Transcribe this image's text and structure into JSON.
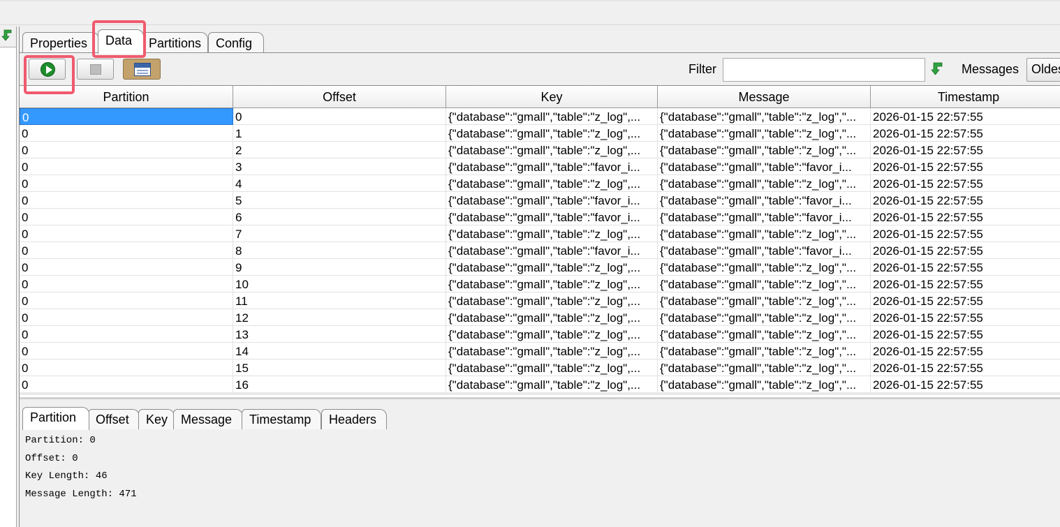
{
  "tabs": [
    {
      "label": "Properties",
      "active": false
    },
    {
      "label": "Data",
      "active": true
    },
    {
      "label": "Partitions",
      "active": false
    },
    {
      "label": "Config",
      "active": false
    }
  ],
  "toolbar": {
    "filter_label": "Filter",
    "filter_value": "",
    "messages_label": "Messages",
    "messages_value": "Oldest"
  },
  "table": {
    "columns": [
      "Partition",
      "Offset",
      "Key",
      "Message",
      "Timestamp"
    ],
    "selected_row": 0,
    "rows": [
      [
        "0",
        "0",
        "{\"database\":\"gmall\",\"table\":\"z_log\",...",
        "{\"database\":\"gmall\",\"table\":\"z_log\",\"...",
        "2026-01-15 22:57:55"
      ],
      [
        "0",
        "1",
        "{\"database\":\"gmall\",\"table\":\"z_log\",...",
        "{\"database\":\"gmall\",\"table\":\"z_log\",\"...",
        "2026-01-15 22:57:55"
      ],
      [
        "0",
        "2",
        "{\"database\":\"gmall\",\"table\":\"z_log\",...",
        "{\"database\":\"gmall\",\"table\":\"z_log\",\"...",
        "2026-01-15 22:57:55"
      ],
      [
        "0",
        "3",
        "{\"database\":\"gmall\",\"table\":\"favor_i...",
        "{\"database\":\"gmall\",\"table\":\"favor_i...",
        "2026-01-15 22:57:55"
      ],
      [
        "0",
        "4",
        "{\"database\":\"gmall\",\"table\":\"z_log\",...",
        "{\"database\":\"gmall\",\"table\":\"z_log\",\"...",
        "2026-01-15 22:57:55"
      ],
      [
        "0",
        "5",
        "{\"database\":\"gmall\",\"table\":\"favor_i...",
        "{\"database\":\"gmall\",\"table\":\"favor_i...",
        "2026-01-15 22:57:55"
      ],
      [
        "0",
        "6",
        "{\"database\":\"gmall\",\"table\":\"favor_i...",
        "{\"database\":\"gmall\",\"table\":\"favor_i...",
        "2026-01-15 22:57:55"
      ],
      [
        "0",
        "7",
        "{\"database\":\"gmall\",\"table\":\"z_log\",...",
        "{\"database\":\"gmall\",\"table\":\"z_log\",\"...",
        "2026-01-15 22:57:55"
      ],
      [
        "0",
        "8",
        "{\"database\":\"gmall\",\"table\":\"favor_i...",
        "{\"database\":\"gmall\",\"table\":\"favor_i...",
        "2026-01-15 22:57:55"
      ],
      [
        "0",
        "9",
        "{\"database\":\"gmall\",\"table\":\"z_log\",...",
        "{\"database\":\"gmall\",\"table\":\"z_log\",\"...",
        "2026-01-15 22:57:55"
      ],
      [
        "0",
        "10",
        "{\"database\":\"gmall\",\"table\":\"z_log\",...",
        "{\"database\":\"gmall\",\"table\":\"z_log\",\"...",
        "2026-01-15 22:57:55"
      ],
      [
        "0",
        "11",
        "{\"database\":\"gmall\",\"table\":\"z_log\",...",
        "{\"database\":\"gmall\",\"table\":\"z_log\",\"...",
        "2026-01-15 22:57:55"
      ],
      [
        "0",
        "12",
        "{\"database\":\"gmall\",\"table\":\"z_log\",...",
        "{\"database\":\"gmall\",\"table\":\"z_log\",\"...",
        "2026-01-15 22:57:55"
      ],
      [
        "0",
        "13",
        "{\"database\":\"gmall\",\"table\":\"z_log\",...",
        "{\"database\":\"gmall\",\"table\":\"z_log\",\"...",
        "2026-01-15 22:57:55"
      ],
      [
        "0",
        "14",
        "{\"database\":\"gmall\",\"table\":\"z_log\",...",
        "{\"database\":\"gmall\",\"table\":\"z_log\",\"...",
        "2026-01-15 22:57:55"
      ],
      [
        "0",
        "15",
        "{\"database\":\"gmall\",\"table\":\"z_log\",...",
        "{\"database\":\"gmall\",\"table\":\"z_log\",\"...",
        "2026-01-15 22:57:55"
      ],
      [
        "0",
        "16",
        "{\"database\":\"gmall\",\"table\":\"z_log\",...",
        "{\"database\":\"gmall\",\"table\":\"z_log\",\"...",
        "2026-01-15 22:57:55"
      ]
    ]
  },
  "detail": {
    "tabs": [
      {
        "label": "Partition",
        "active": true
      },
      {
        "label": "Offset",
        "active": false
      },
      {
        "label": "Key",
        "active": false
      },
      {
        "label": "Message",
        "active": false
      },
      {
        "label": "Timestamp",
        "active": false
      },
      {
        "label": "Headers",
        "active": false
      }
    ],
    "lines": [
      "Partition: 0",
      "Offset: 0",
      "Key Length: 46",
      "Message Length: 471"
    ]
  },
  "icons": {
    "play": "play-icon",
    "stop": "stop-icon",
    "view": "window-view-icon",
    "apply_filter": "green-down-arrow-icon"
  },
  "colors": {
    "selection": "#3399ff",
    "play_green": "#1e8d2c",
    "highlight": "#f05a6e"
  }
}
